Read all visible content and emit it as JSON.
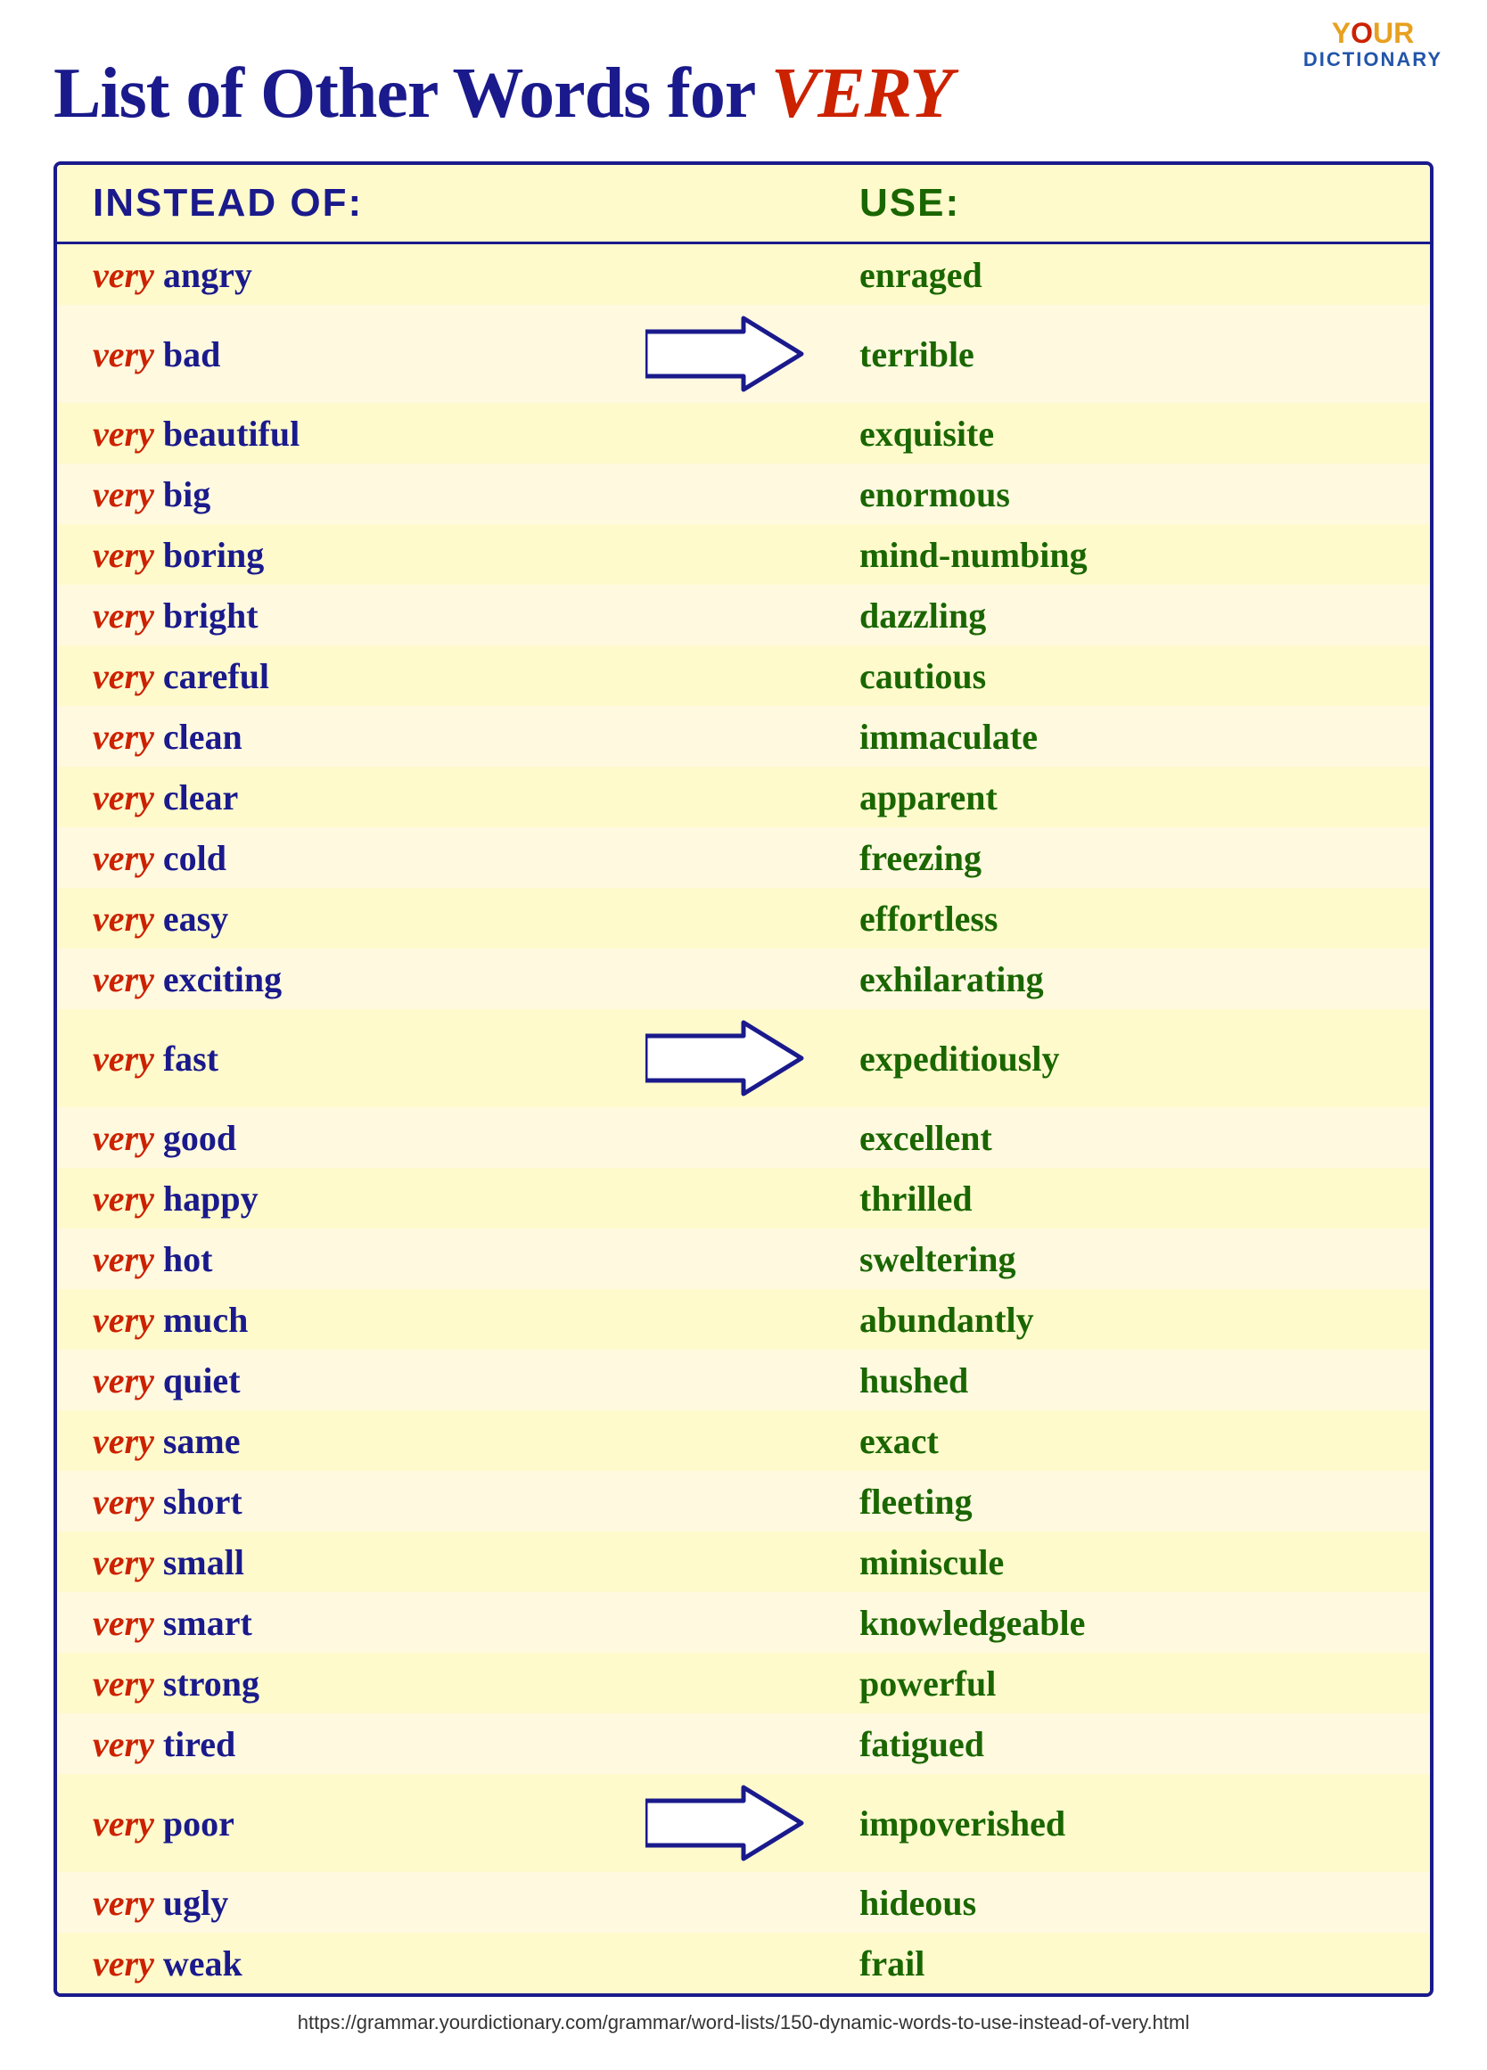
{
  "logo": {
    "your": "YOUR",
    "dictionary": "DICTIONARY"
  },
  "title": {
    "prefix": "List of Other Words for ",
    "highlight": "VERY"
  },
  "header": {
    "instead": "INSTEAD OF:",
    "use": "USE:"
  },
  "rows": [
    {
      "very": "very",
      "word": "angry",
      "replacement": "enraged",
      "arrow": false
    },
    {
      "very": "very",
      "word": "bad",
      "replacement": "terrible",
      "arrow": true
    },
    {
      "very": "very",
      "word": "beautiful",
      "replacement": "exquisite",
      "arrow": false
    },
    {
      "very": "very",
      "word": "big",
      "replacement": "enormous",
      "arrow": false
    },
    {
      "very": "very",
      "word": "boring",
      "replacement": "mind-numbing",
      "arrow": false
    },
    {
      "very": "very",
      "word": "bright",
      "replacement": "dazzling",
      "arrow": false
    },
    {
      "very": "very",
      "word": "careful",
      "replacement": "cautious",
      "arrow": false
    },
    {
      "very": "very",
      "word": "clean",
      "replacement": "immaculate",
      "arrow": false
    },
    {
      "very": "very",
      "word": "clear",
      "replacement": "apparent",
      "arrow": false
    },
    {
      "very": "very",
      "word": "cold",
      "replacement": "freezing",
      "arrow": false
    },
    {
      "very": "very",
      "word": "easy",
      "replacement": "effortless",
      "arrow": false
    },
    {
      "very": "very",
      "word": "exciting",
      "replacement": "exhilarating",
      "arrow": false
    },
    {
      "very": "very",
      "word": "fast",
      "replacement": "expeditiously",
      "arrow": true
    },
    {
      "very": "very",
      "word": "good",
      "replacement": "excellent",
      "arrow": false
    },
    {
      "very": "very",
      "word": "happy",
      "replacement": "thrilled",
      "arrow": false
    },
    {
      "very": "very",
      "word": "hot",
      "replacement": "sweltering",
      "arrow": false
    },
    {
      "very": "very",
      "word": "much",
      "replacement": "abundantly",
      "arrow": false
    },
    {
      "very": "very",
      "word": "quiet",
      "replacement": "hushed",
      "arrow": false
    },
    {
      "very": "very",
      "word": "same",
      "replacement": "exact",
      "arrow": false
    },
    {
      "very": "very",
      "word": "short",
      "replacement": "fleeting",
      "arrow": false
    },
    {
      "very": "very",
      "word": "small",
      "replacement": "miniscule",
      "arrow": false
    },
    {
      "very": "very",
      "word": "smart",
      "replacement": "knowledgeable",
      "arrow": false
    },
    {
      "very": "very",
      "word": "strong",
      "replacement": "powerful",
      "arrow": false
    },
    {
      "very": "very",
      "word": "tired",
      "replacement": "fatigued",
      "arrow": false
    },
    {
      "very": "very",
      "word": "poor",
      "replacement": "impoverished",
      "arrow": true
    },
    {
      "very": "very",
      "word": "ugly",
      "replacement": "hideous",
      "arrow": false
    },
    {
      "very": "very",
      "word": "weak",
      "replacement": "frail",
      "arrow": false
    }
  ],
  "footer": {
    "url": "https://grammar.yourdictionary.com/grammar/word-lists/150-dynamic-words-to-use-instead-of-very.html"
  }
}
